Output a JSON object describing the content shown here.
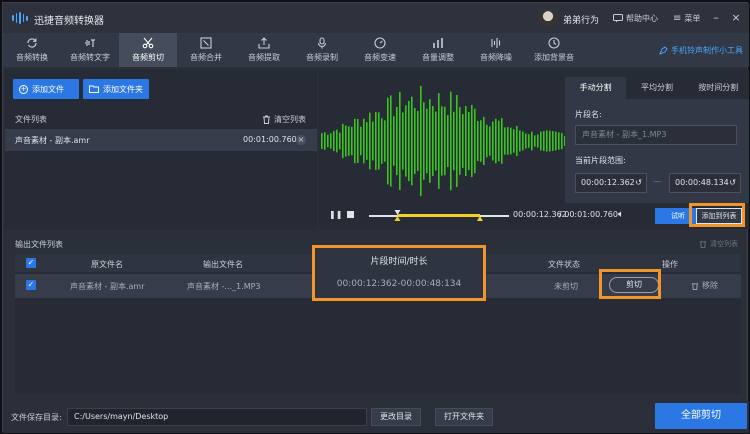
{
  "app": {
    "title": "迅捷音频转换器",
    "username": "弟弟行为",
    "help_label": "帮助中心",
    "menu_label": "菜单"
  },
  "toolbar": {
    "tools": [
      {
        "label": "音频转换",
        "icon": "convert-icon"
      },
      {
        "label": "音频转文字",
        "icon": "audio-to-text-icon"
      },
      {
        "label": "音频剪切",
        "icon": "scissors-icon"
      },
      {
        "label": "音频合并",
        "icon": "merge-icon"
      },
      {
        "label": "音频提取",
        "icon": "extract-icon"
      },
      {
        "label": "音频录制",
        "icon": "microphone-icon"
      },
      {
        "label": "音频变速",
        "icon": "speed-icon"
      },
      {
        "label": "音量调整",
        "icon": "volume-adjust-icon"
      },
      {
        "label": "音频降噪",
        "icon": "denoise-icon"
      },
      {
        "label": "添加背景音",
        "icon": "background-music-icon"
      }
    ],
    "active_index": 2,
    "ringtone_label": "手机铃声制作小工具"
  },
  "files": {
    "add_file": "添加文件",
    "add_folder": "添加文件夹",
    "list_title": "文件列表",
    "clear_list": "清空列表",
    "items": [
      {
        "name": "声音素材 - 副本.amr",
        "duration": "00:01:00.760"
      }
    ]
  },
  "split": {
    "tabs": [
      "手动分割",
      "平均分割",
      "按时间分割"
    ],
    "active_tab": 0,
    "segment_name_label": "片段名:",
    "segment_name_placeholder": "声音素材 - 副本_1.MP3",
    "range_label": "当前片段范围:",
    "range_start": "00:00:12.362",
    "range_separator": "—",
    "range_end": "00:00:48.134",
    "current_time": "00:00:12.362",
    "total_time": "/ 00:01:00.760",
    "audition_label": "试听",
    "add_to_list_label": "添加到列表",
    "playhead_fraction": 0.2035,
    "selection_end_fraction": 0.7922,
    "waveform_color": "#3cc41e",
    "selection_color": "#f0d21f"
  },
  "output": {
    "title": "输出文件列表",
    "clear_list": "清空列表",
    "columns": {
      "source": "原文件名",
      "output": "输出文件名",
      "segment": "片段时间/时长",
      "status": "文件状态",
      "action": "操作"
    },
    "rows": [
      {
        "source": "声音素材 - 副本.amr",
        "output": "声音素材 -..._1.MP3",
        "segment": "00:00:12:362-00:00:48:134",
        "status": "未剪切",
        "cut": "剪切",
        "remove": "移除"
      }
    ]
  },
  "footer": {
    "save_dir_label": "文件保存目录:",
    "save_dir": "C:/Users/mayn/Desktop",
    "change_dir": "更改目录",
    "open_folder": "打开文件夹",
    "cut_all": "全部剪切"
  },
  "colors": {
    "accent": "#2b78e4",
    "highlight": "#f0962a",
    "background": "#2a2f3a"
  }
}
